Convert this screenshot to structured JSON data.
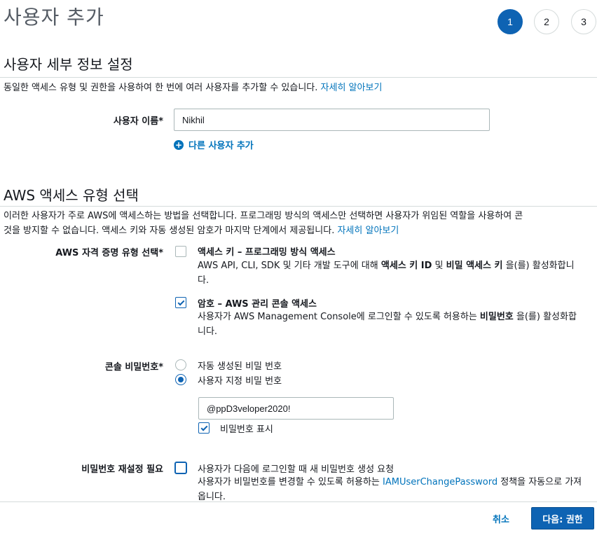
{
  "header": {
    "title": "사용자 추가",
    "steps": [
      "1",
      "2",
      "3"
    ],
    "active_step": "1"
  },
  "user_details": {
    "section_title": "사용자 세부 정보 설정",
    "description": "동일한 액세스 유형 및 권한을 사용하여 한 번에 여러 사용자를 추가할 수 있습니다.",
    "learn_more": "자세히 알아보기",
    "username_label": "사용자 이름*",
    "username_value": "Nikhil",
    "add_user_label": "다른 사용자 추가"
  },
  "access_type": {
    "section_title": "AWS 액세스 유형 선택",
    "description_line1": "이러한 사용자가 주로 AWS에 액세스하는 방법을 선택합니다. 프로그래밍 방식의 액세스만 선택하면 사용자가 위임된 역할을 사용하여 콘",
    "description_line2": "것을 방지할 수 없습니다. 액세스 키와 자동 생성된 암호가 마지막 단계에서 제공됩니다.",
    "learn_more": "자세히 알아보기",
    "credential_label": "AWS 자격 증명 유형 선택*",
    "programmatic": {
      "title": "액세스 키 – 프로그래밍 방식 액세스",
      "desc_a": "AWS API, CLI, SDK 및 기타 개발 도구에 대해 ",
      "desc_b1": "액세스 키 ID",
      "desc_c": " 및 ",
      "desc_b2": "비밀 액세스 키",
      "desc_d": " 을(를) 활성화합니다.",
      "checked": false
    },
    "console": {
      "title": "암호 – AWS 관리 콘솔 액세스",
      "desc_a": "사용자가 AWS Management Console에 로그인할 수 있도록 허용하는 ",
      "desc_b": "비밀번호",
      "desc_c": " 을(를) 활성화합니다.",
      "checked": true
    }
  },
  "console_password": {
    "label": "콘솔 비밀번호*",
    "auto_option": "자동 생성된 비밀 번호",
    "custom_option": "사용자 지정 비밀 번호",
    "selected": "custom",
    "password_value": "@ppD3veloper2020!",
    "show_password_label": "비밀번호 표시",
    "show_password_checked": true
  },
  "reset_password": {
    "label": "비밀번호 재설정 필요",
    "option_text": "사용자가 다음에 로그인할 때 새 비밀번호 생성 요청",
    "desc_a": "사용자가 비밀번호를 변경할 수 있도록 허용하는 ",
    "policy_link": "IAMUserChangePassword",
    "desc_b": " 정책을 자동으로 가져옵니다.",
    "checked": false
  },
  "footer": {
    "cancel_label": "취소",
    "next_label": "다음: 권한"
  },
  "colors": {
    "primary": "#0e63b3",
    "link": "#0073bb",
    "title_gray": "#545b64",
    "divider": "#d5dbdb"
  }
}
